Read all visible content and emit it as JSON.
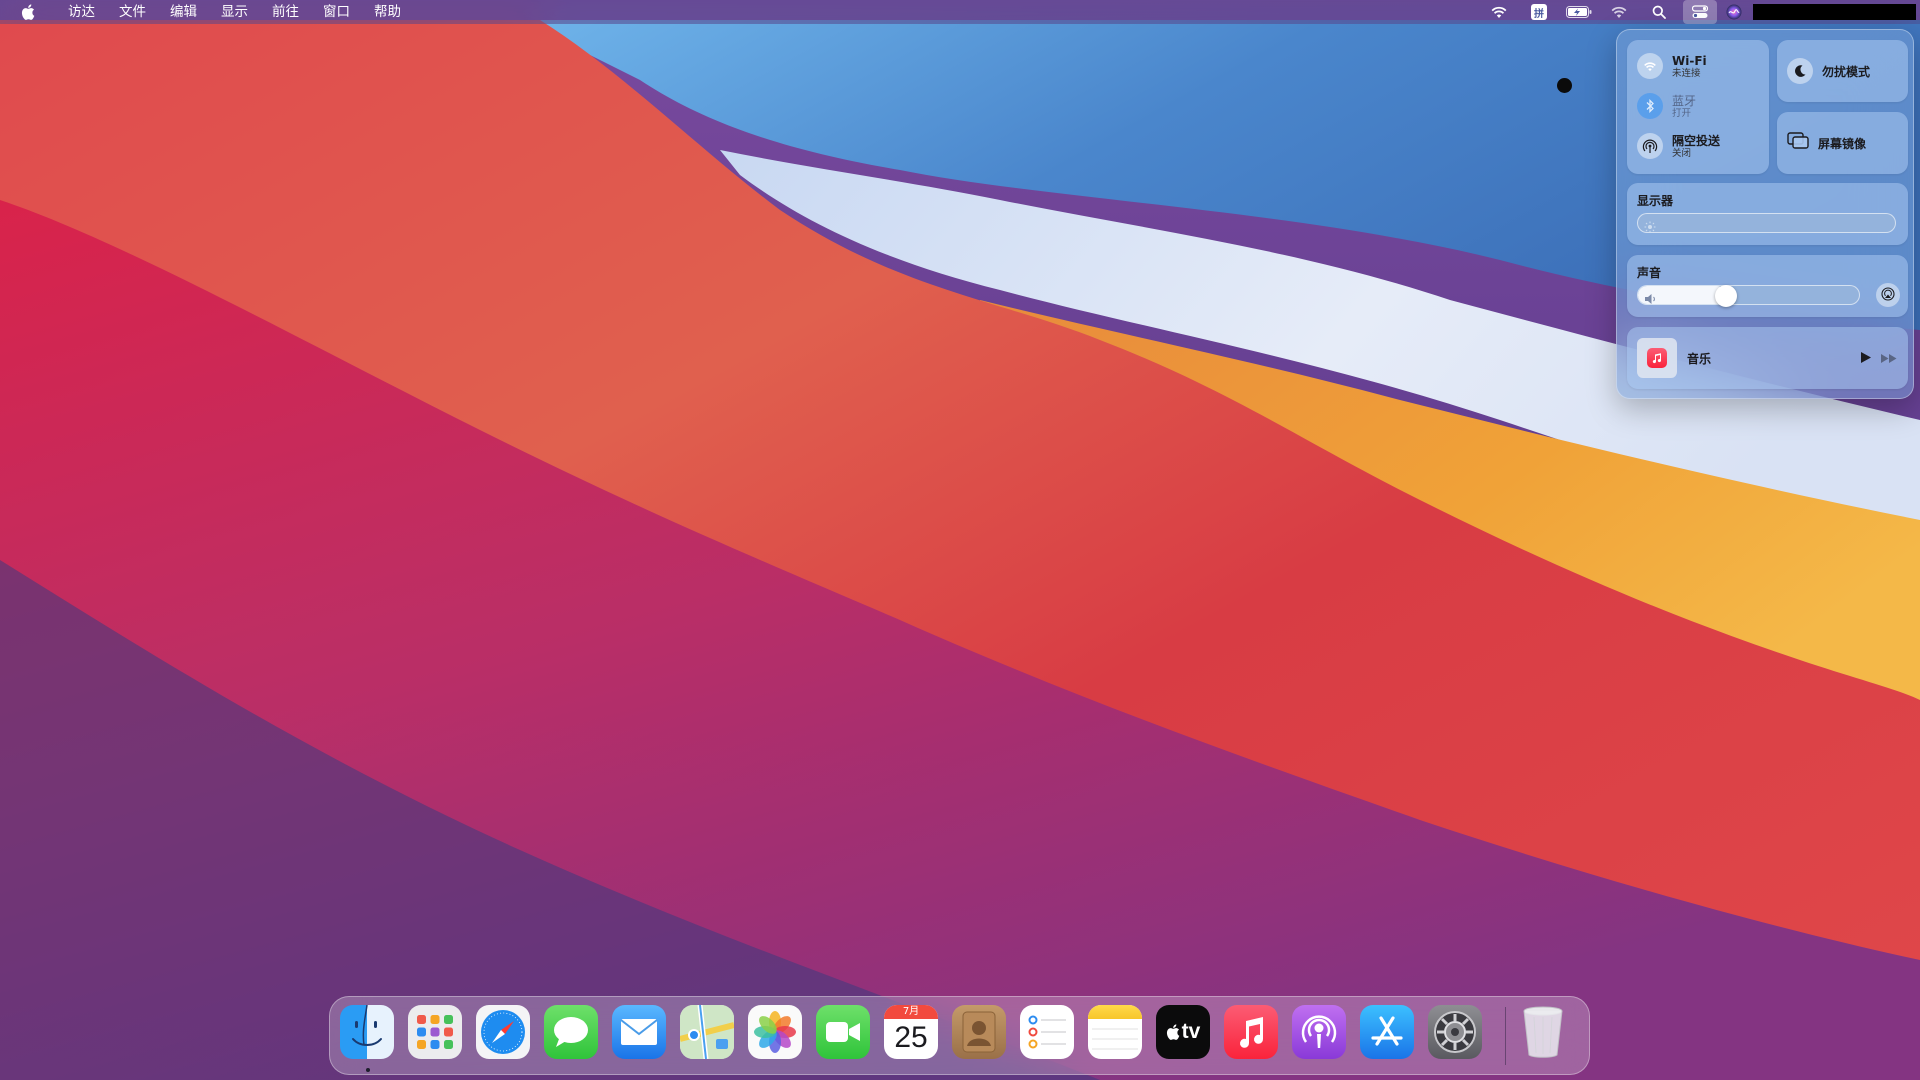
{
  "menubar": {
    "menus": [
      "访达",
      "文件",
      "编辑",
      "显示",
      "前往",
      "窗口",
      "帮助"
    ],
    "status_icons": [
      "wifi-icon",
      "input-method-icon",
      "battery-icon",
      "wifi-icon",
      "search-icon",
      "control-center-icon",
      "siri-icon"
    ],
    "input_method_label": "拼"
  },
  "control_center": {
    "wifi": {
      "title": "Wi-Fi",
      "status": "未连接"
    },
    "bluetooth": {
      "title": "蓝牙",
      "status": "打开"
    },
    "airdrop": {
      "title": "隔空投送",
      "status": "关闭"
    },
    "do_not_disturb": {
      "label": "勿扰模式"
    },
    "screen_mirroring": {
      "label": "屏幕镜像"
    },
    "display": {
      "title": "显示器",
      "brightness": 0
    },
    "sound": {
      "title": "声音",
      "volume": 0.4
    },
    "now_playing": {
      "label": "音乐"
    }
  },
  "dock": {
    "apps": [
      {
        "name": "finder",
        "running": true
      },
      {
        "name": "launchpad"
      },
      {
        "name": "safari"
      },
      {
        "name": "messages"
      },
      {
        "name": "mail"
      },
      {
        "name": "maps"
      },
      {
        "name": "photos"
      },
      {
        "name": "facetime"
      },
      {
        "name": "calendar",
        "month": "7月",
        "day": "25"
      },
      {
        "name": "contacts"
      },
      {
        "name": "reminders"
      },
      {
        "name": "notes"
      },
      {
        "name": "tv",
        "label": "tv"
      },
      {
        "name": "music"
      },
      {
        "name": "podcasts"
      },
      {
        "name": "app-store"
      },
      {
        "name": "system-preferences"
      }
    ],
    "trash": {
      "name": "trash"
    }
  },
  "colors": {
    "accent": "#0a84ff",
    "music_red": "#fa233b",
    "wallpaper_red": "#e0344e",
    "wallpaper_orange": "#f0a238",
    "wallpaper_blue": "#4f8fd8"
  }
}
